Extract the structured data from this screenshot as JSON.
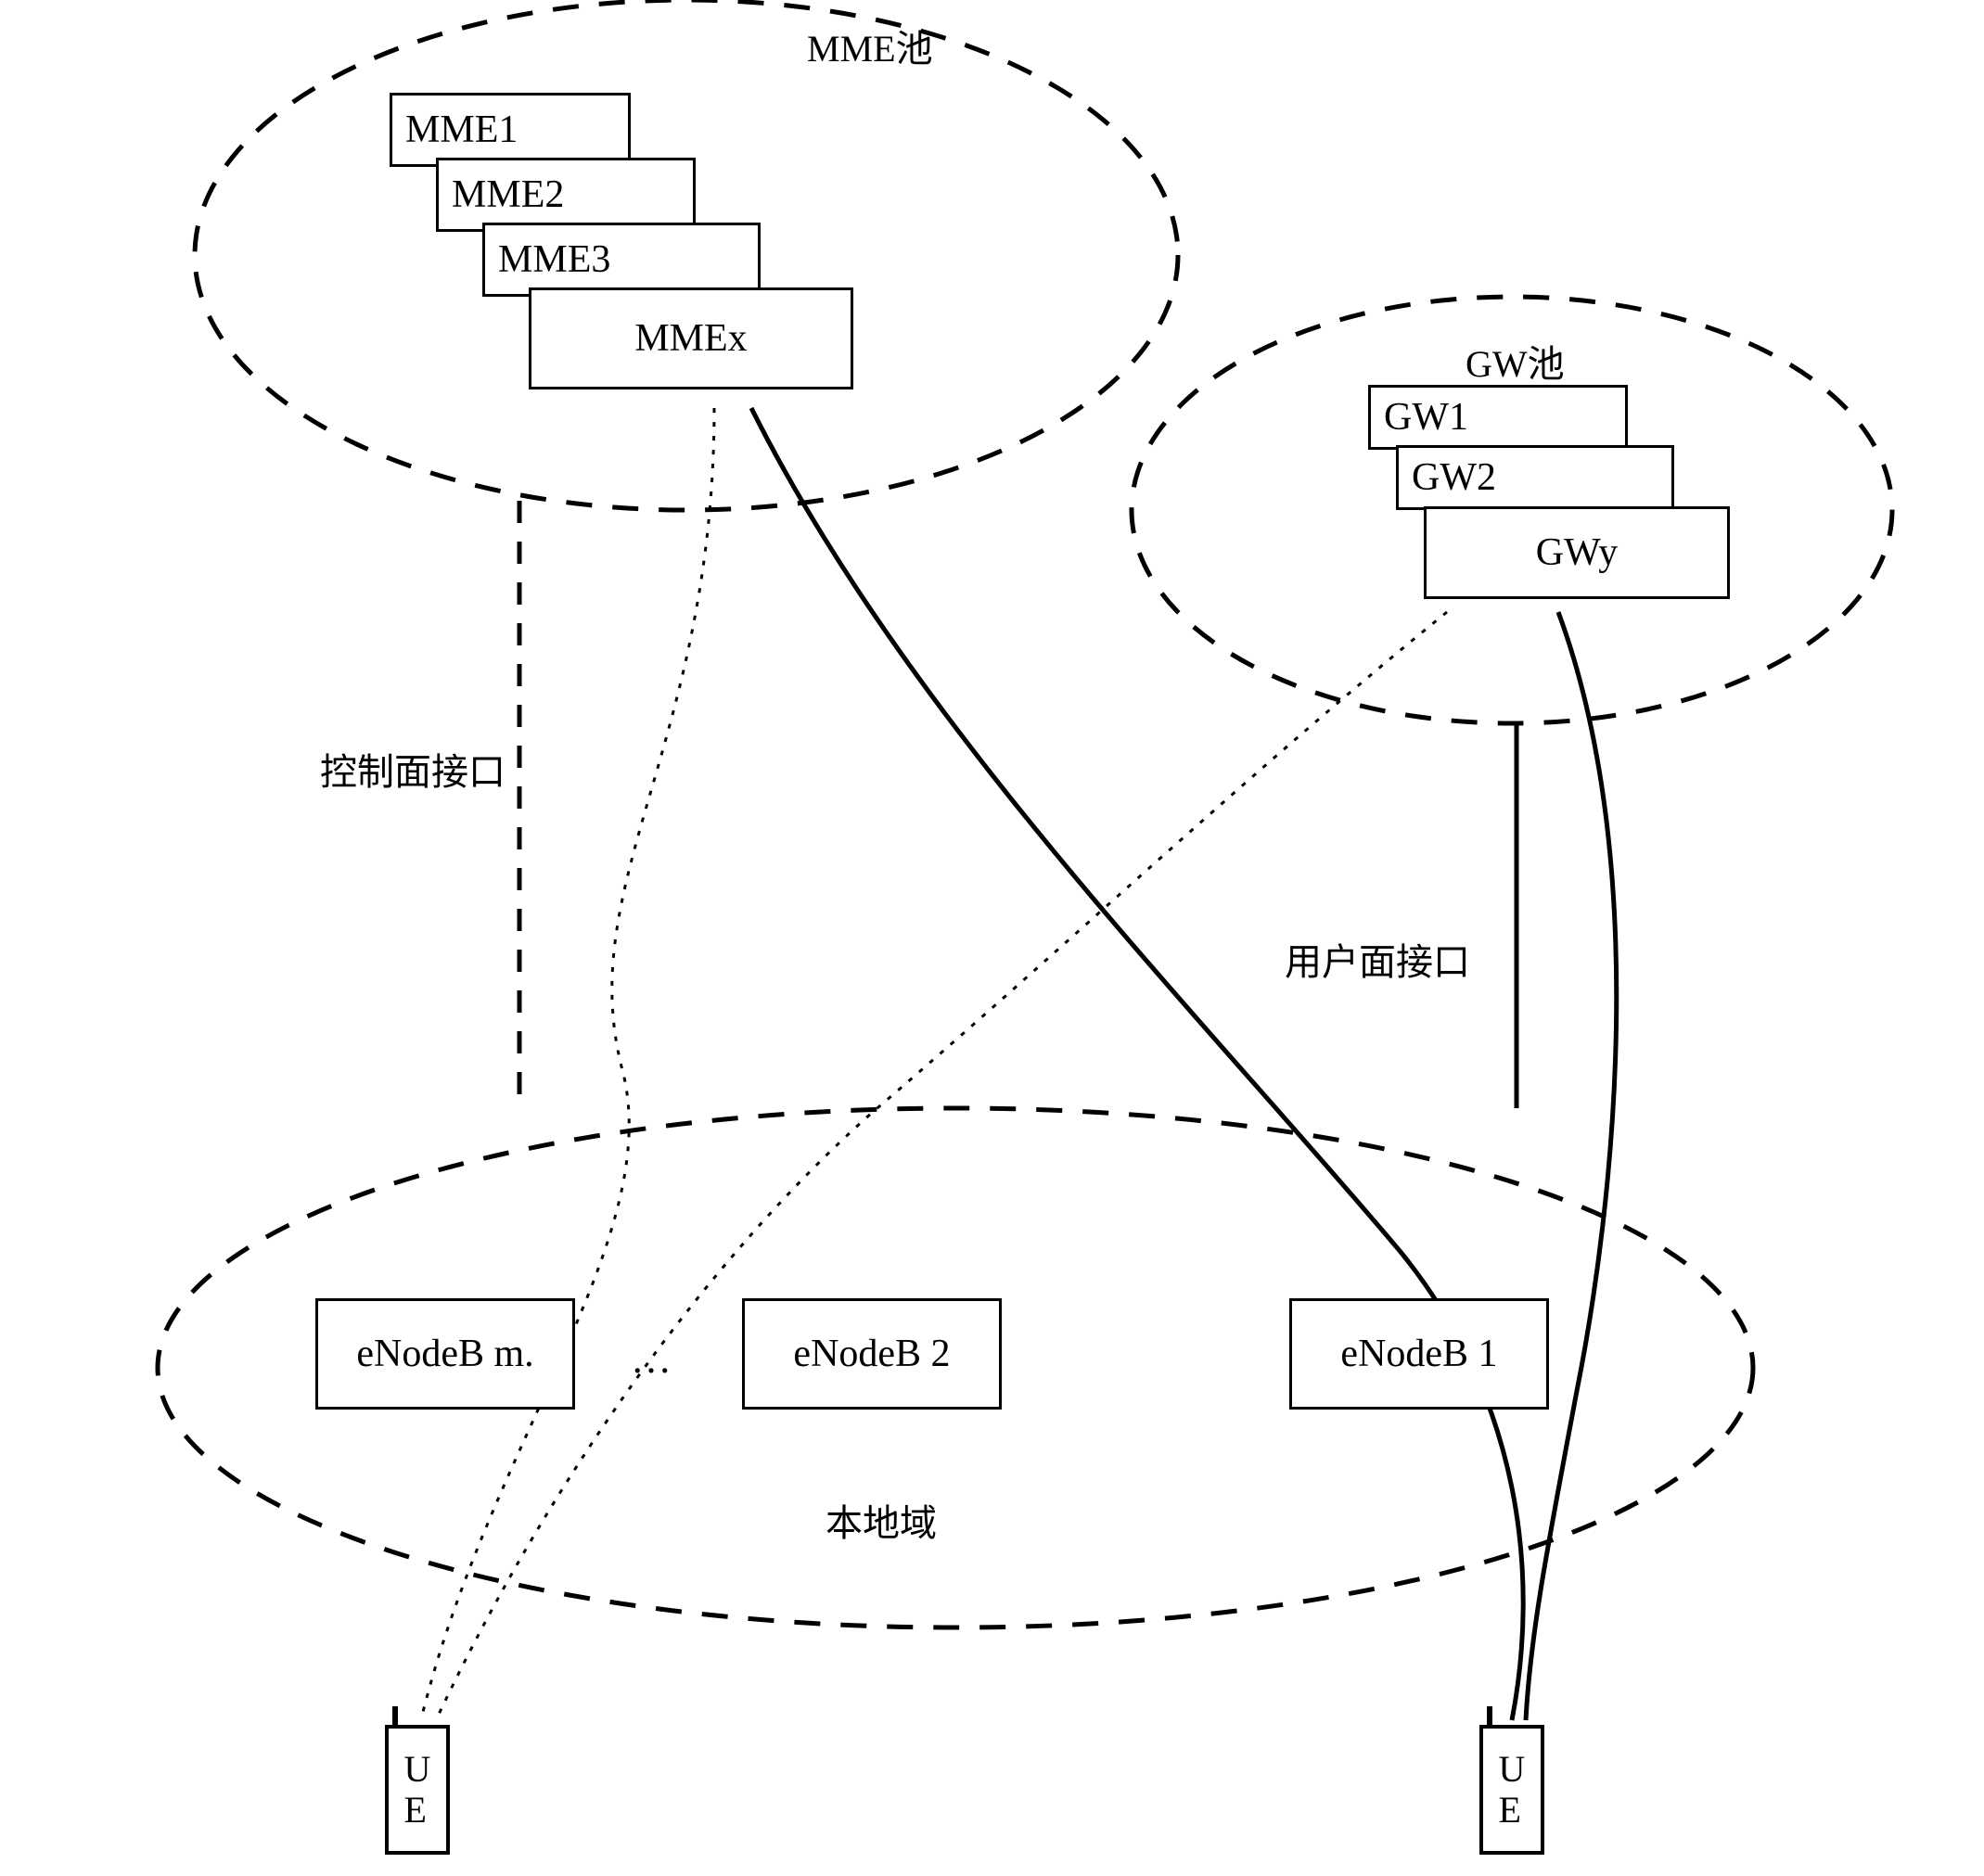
{
  "mme_pool": {
    "title": "MME池",
    "nodes": [
      "MME1",
      "MME2",
      "MME3",
      "MMEx"
    ]
  },
  "gw_pool": {
    "title": "GW池",
    "nodes": [
      "GW1",
      "GW2",
      "GWy"
    ]
  },
  "enodeb_area": {
    "title": "本地域",
    "nodes": [
      "eNodeB m.",
      "eNodeB 2",
      "eNodeB 1"
    ],
    "ellipsis": "…"
  },
  "interfaces": {
    "control_plane": "控制面接口",
    "user_plane": "用户面接口"
  },
  "ue_label": "U\nE"
}
